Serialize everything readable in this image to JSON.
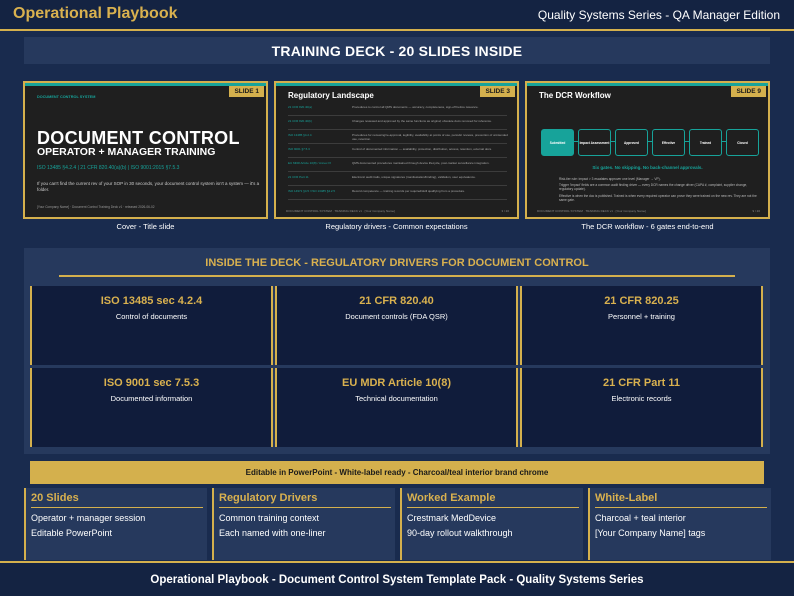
{
  "header": {
    "brand": "Operational Playbook",
    "edition": "Quality Systems Series - QA Manager Edition"
  },
  "deck_banner": "TRAINING DECK  -  20 SLIDES INSIDE",
  "slides": [
    {
      "tag": "SLIDE 1",
      "kicker": "DOCUMENT CONTROL SYSTEM",
      "title": "DOCUMENT CONTROL",
      "subtitle": "OPERATOR + MANAGER TRAINING",
      "refs": "ISO 13485 §4.2.4  |  21 CFR 820.40(a)(b)  |  ISO 9001:2015 §7.5.3",
      "body": "If you can't find the current rev of your SOP in 30 seconds, your document control system isn't a system — it's a folder.",
      "footer": "[Your Company Name]  ·  Document Control Training Deck v1  ·  released 2026-06-02",
      "caption": "Cover  -  Title slide"
    },
    {
      "tag": "SLIDE 3",
      "title": "Regulatory Landscape",
      "rows": [
        {
          "k": "21 CFR 820.40(a)",
          "v": "Procedures to control all QMS documents — accuracy, completeness, sign-off before issuance."
        },
        {
          "k": "21 CFR 820.40(b)",
          "v": "Changes reviewed and approved by the same functions as original; obsolete docs removed for reference."
        },
        {
          "k": "ISO 13485 §4.2.4",
          "v": "Procedures for reviewing/re-approval, legibility, availability at points of use, periodic reviews, prevention of unintended use, retention."
        },
        {
          "k": "ISO 9001 §7.5.3",
          "v": "Control of documented information — availability, protection, distribution, access, retention, external docs."
        },
        {
          "k": "EU MDR Article 10(8) / Annex IX",
          "v": "QMS documented procedures maintained through device lifecycle, post-market surveillance integration."
        },
        {
          "k": "21 CFR Part 11",
          "v": "Electronic audit trails, unique signatures (manifestation/binding), validation, user equivalence."
        },
        {
          "k": "ISO 14971 §4.5 / ISO 13485 §4.2.5",
          "v": "Record competence — training records per required/skill qualifying from a procedure."
        }
      ],
      "footer": "DOCUMENT CONTROL SYSTEM  ·  TRAINING DECK v1  ·  [Your Company Name]",
      "page": "3 / 20",
      "caption": "Regulatory drivers  -  Common expectations"
    },
    {
      "tag": "SLIDE 9",
      "title": "The DCR Workflow",
      "flow": [
        "Submitted",
        "Impact Assessment",
        "Approved",
        "Effective",
        "Trained",
        "Closed"
      ],
      "gates": "Six gates. No skipping. No back-channel approvals.",
      "notes": [
        "Risk-tier rule: impact > 3 escalates approver one level (Manager → VP).",
        "Trigger 'Impact' fields are a common audit finding driver — every DCR names the change driver (CAPA #, complaint, supplier change, regulatory update).",
        "Effective is when the doc is published. Trained is when every required operator can prove they were trained on the new rev. They are not the same gate."
      ],
      "footer": "DOCUMENT CONTROL SYSTEM  ·  TRAINING DECK v1  ·  [Your Company Name]",
      "page": "9 / 20",
      "caption": "The DCR workflow  -  6 gates end-to-end"
    }
  ],
  "inside": {
    "title": "INSIDE THE DECK  -  REGULATORY DRIVERS FOR DOCUMENT CONTROL",
    "cards": [
      {
        "title": "ISO 13485 sec 4.2.4",
        "desc": "Control of documents"
      },
      {
        "title": "21 CFR 820.40",
        "desc": "Document controls (FDA QSR)"
      },
      {
        "title": "21 CFR 820.25",
        "desc": "Personnel + training"
      },
      {
        "title": "ISO 9001 sec 7.5.3",
        "desc": "Documented information"
      },
      {
        "title": "EU MDR Article 10(8)",
        "desc": "Technical documentation"
      },
      {
        "title": "21 CFR Part 11",
        "desc": "Electronic records"
      }
    ]
  },
  "gold_banner": "Editable in PowerPoint  -  White-label ready  -  Charcoal/teal interior brand chrome",
  "features": [
    {
      "title": "20 Slides",
      "line1": "Operator + manager session",
      "line2": "Editable PowerPoint"
    },
    {
      "title": "Regulatory Drivers",
      "line1": "Common training context",
      "line2": "Each named with one-liner"
    },
    {
      "title": "Worked Example",
      "line1": "Crestmark MedDevice",
      "line2": "90-day rollout walkthrough"
    },
    {
      "title": "White-Label",
      "line1": "Charcoal + teal interior",
      "line2": "[Your Company Name] tags"
    }
  ],
  "footer": "Operational Playbook  -  Document Control System Template Pack  -  Quality Systems Series",
  "colors": {
    "navy": "#192b4e",
    "panel": "#26395d",
    "gold": "#d4b04d",
    "teal": "#17a39a",
    "charcoal": "#1f1f1f"
  }
}
